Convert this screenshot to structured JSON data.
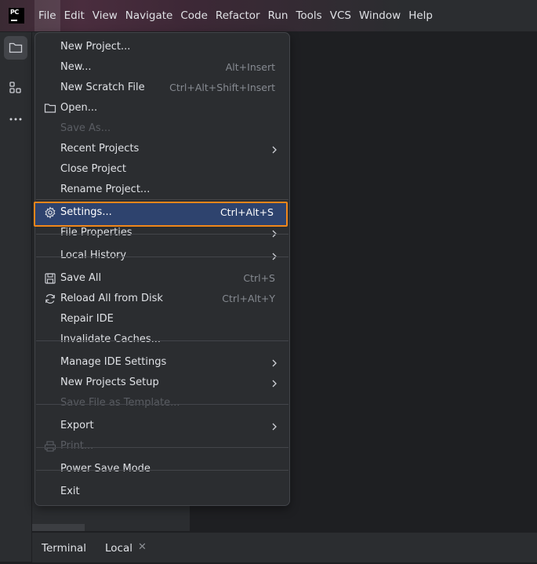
{
  "menubar": {
    "items": [
      "File",
      "Edit",
      "View",
      "Navigate",
      "Code",
      "Refactor",
      "Run",
      "Tools",
      "VCS",
      "Window",
      "Help"
    ]
  },
  "file_menu": {
    "items": [
      {
        "label": "New Project...",
        "shortcut": "",
        "submenu": false,
        "disabled": false
      },
      {
        "label": "New...",
        "shortcut": "Alt+Insert",
        "submenu": false,
        "disabled": false
      },
      {
        "label": "New Scratch File",
        "shortcut": "Ctrl+Alt+Shift+Insert",
        "submenu": false,
        "disabled": false
      },
      {
        "label": "Open...",
        "shortcut": "",
        "submenu": false,
        "disabled": false,
        "icon": "folder-icon"
      },
      {
        "label": "Save As...",
        "shortcut": "",
        "submenu": false,
        "disabled": true
      },
      {
        "label": "Recent Projects",
        "shortcut": "",
        "submenu": true,
        "disabled": false
      },
      {
        "label": "Close Project",
        "shortcut": "",
        "submenu": false,
        "disabled": false
      },
      {
        "label": "Rename Project...",
        "shortcut": "",
        "submenu": false,
        "disabled": false
      },
      {
        "label": "Settings...",
        "shortcut": "Ctrl+Alt+S",
        "submenu": false,
        "disabled": false,
        "icon": "gear-icon",
        "selected": true
      },
      {
        "label": "File Properties",
        "shortcut": "",
        "submenu": true,
        "disabled": false
      },
      {
        "label": "Local History",
        "shortcut": "",
        "submenu": true,
        "disabled": false
      },
      {
        "label": "Save All",
        "shortcut": "Ctrl+S",
        "submenu": false,
        "disabled": false,
        "icon": "save-icon"
      },
      {
        "label": "Reload All from Disk",
        "shortcut": "Ctrl+Alt+Y",
        "submenu": false,
        "disabled": false,
        "icon": "reload-icon"
      },
      {
        "label": "Repair IDE",
        "shortcut": "",
        "submenu": false,
        "disabled": false
      },
      {
        "label": "Invalidate Caches...",
        "shortcut": "",
        "submenu": false,
        "disabled": false
      },
      {
        "label": "Manage IDE Settings",
        "shortcut": "",
        "submenu": true,
        "disabled": false
      },
      {
        "label": "New Projects Setup",
        "shortcut": "",
        "submenu": true,
        "disabled": false
      },
      {
        "label": "Save File as Template...",
        "shortcut": "",
        "submenu": false,
        "disabled": true
      },
      {
        "label": "Export",
        "shortcut": "",
        "submenu": true,
        "disabled": false
      },
      {
        "label": "Print...",
        "shortcut": "",
        "submenu": false,
        "disabled": true,
        "icon": "print-icon"
      },
      {
        "label": "Power Save Mode",
        "shortcut": "",
        "submenu": false,
        "disabled": false
      },
      {
        "label": "Exit",
        "shortcut": "",
        "submenu": false,
        "disabled": false
      }
    ]
  },
  "toolwindow": {
    "terminal_label": "Terminal",
    "local_tab_label": "Local"
  },
  "colors": {
    "highlight_border": "#f0861a",
    "selection_bg": "#2e436e"
  }
}
